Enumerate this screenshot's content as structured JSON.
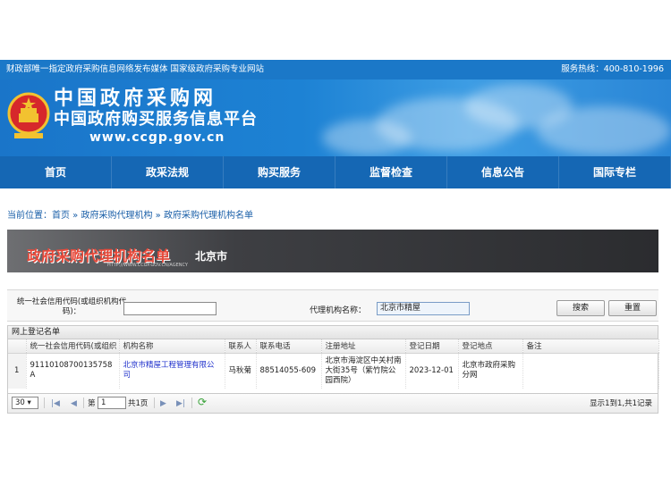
{
  "header": {
    "slogan": "财政部唯一指定政府采购信息网络发布媒体 国家级政府采购专业网站",
    "hotline": "服务热线：400-810-1996",
    "site_title_1": "中国政府采购网",
    "site_title_2": "中国政府购买服务信息平台",
    "site_url": "www.ccgp.gov.cn"
  },
  "nav": {
    "items": [
      "首页",
      "政采法规",
      "购买服务",
      "监督检查",
      "信息公告",
      "国际专栏"
    ]
  },
  "breadcrumb": "当前位置：首页 » 政府采购代理机构 » 政府采购代理机构名单",
  "heading": {
    "title": "政府采购代理机构名单",
    "city": "北京市",
    "url": "HTTP://WWW.CCGP.GOV.CN/AGENCY"
  },
  "search": {
    "credit_code_label": "统一社会信用代码(或组织机构代码)：",
    "credit_code_value": "",
    "agency_name_label": "代理机构名称：",
    "agency_name_value": "北京市精屋",
    "search_button": "搜索",
    "reset_button": "重置"
  },
  "grid": {
    "caption": "网上登记名单",
    "columns": [
      "",
      "统一社会信用代码(或组织",
      "机构名称",
      "联系人",
      "联系电话",
      "注册地址",
      "登记日期",
      "登记地点",
      "备注"
    ],
    "rows": [
      [
        "1",
        "91110108700135758A",
        "北京市精屋工程管理有限公司",
        "马秋菊",
        "88514055-609",
        "北京市海淀区中关村南大街35号（紫竹院公园西院）",
        "2023-12-01",
        "北京市政府采购分网",
        ""
      ]
    ]
  },
  "pager": {
    "page_size": "30",
    "page_label_before": "第",
    "page_value": "1",
    "page_label_after": "共1页",
    "summary": "显示1到1,共1记录"
  },
  "colors": {
    "nav_bg": "#1567b4",
    "top_bar_bg": "#1b78c8",
    "heading_title": "#e8493a",
    "link": "#2233cc"
  }
}
